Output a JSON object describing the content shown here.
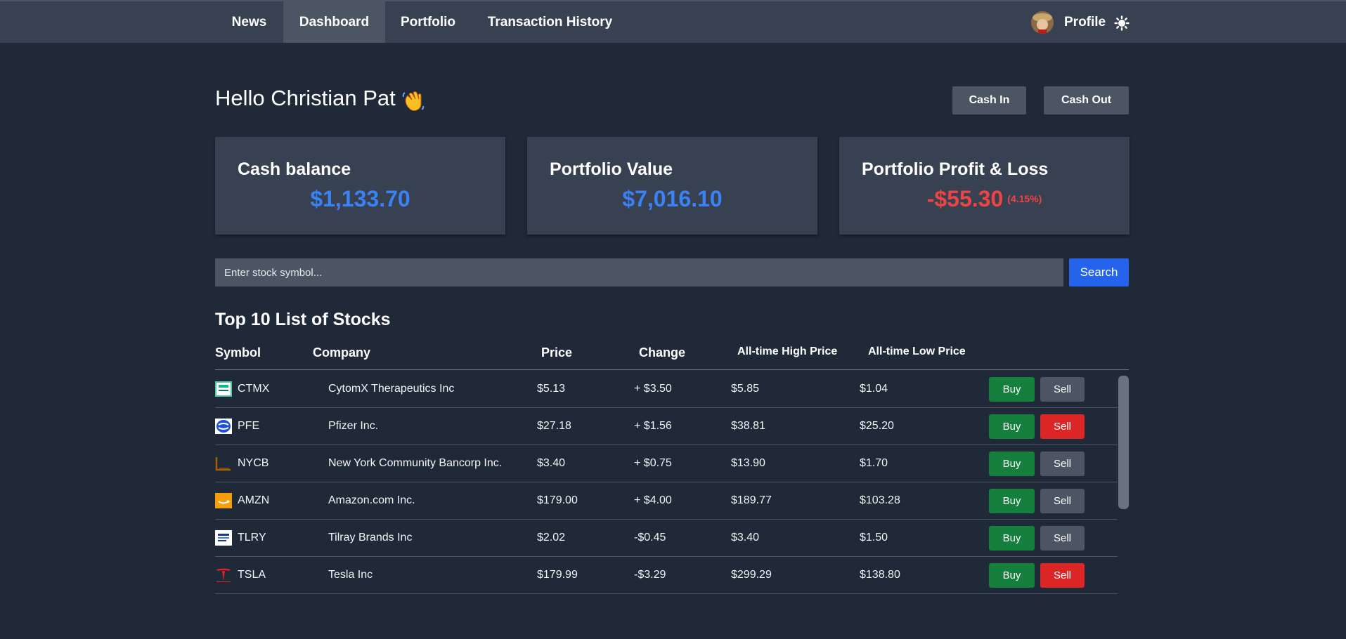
{
  "nav": {
    "items": [
      "News",
      "Dashboard",
      "Portfolio",
      "Transaction History"
    ],
    "active": "Dashboard",
    "profile_label": "Profile"
  },
  "header": {
    "greeting": "Hello Christian Pat",
    "cash_in_label": "Cash In",
    "cash_out_label": "Cash Out"
  },
  "cards": {
    "cash_balance": {
      "title": "Cash balance",
      "value": "$1,133.70"
    },
    "portfolio_value": {
      "title": "Portfolio Value",
      "value": "$7,016.10"
    },
    "profit_loss": {
      "title": "Portfolio Profit & Loss",
      "value": "-$55.30",
      "percent": "(4.15%)"
    }
  },
  "search": {
    "placeholder": "Enter stock symbol...",
    "button_label": "Search"
  },
  "table": {
    "title": "Top 10 List of Stocks",
    "headers": {
      "symbol": "Symbol",
      "company": "Company",
      "price": "Price",
      "change": "Change",
      "high": "All-time High Price",
      "low": "All-time Low Price"
    },
    "buy_label": "Buy",
    "sell_label": "Sell",
    "rows": [
      {
        "symbol": "CTMX",
        "company": "CytomX Therapeutics Inc",
        "price": "$5.13",
        "change": "+ $3.50",
        "high": "$5.85",
        "low": "$1.04"
      },
      {
        "symbol": "PFE",
        "company": "Pfizer Inc.",
        "price": "$27.18",
        "change": "+ $1.56",
        "high": "$38.81",
        "low": "$25.20"
      },
      {
        "symbol": "NYCB",
        "company": "New York Community Bancorp Inc.",
        "price": "$3.40",
        "change": "+ $0.75",
        "high": "$13.90",
        "low": "$1.70"
      },
      {
        "symbol": "AMZN",
        "company": "Amazon.com Inc.",
        "price": "$179.00",
        "change": "+ $4.00",
        "high": "$189.77",
        "low": "$103.28"
      },
      {
        "symbol": "TLRY",
        "company": "Tilray Brands Inc",
        "price": "$2.02",
        "change": "-$0.45",
        "high": "$3.40",
        "low": "$1.50"
      },
      {
        "symbol": "TSLA",
        "company": "Tesla Inc",
        "price": "$179.99",
        "change": "-$3.29",
        "high": "$299.29",
        "low": "$138.80"
      }
    ]
  },
  "colors": {
    "background": "#1f2937",
    "navbar": "#374151",
    "card": "#374151",
    "accent_blue": "#3b82f6",
    "gain_green": "#22c55e",
    "loss_red": "#ef4444",
    "buy_green": "#15803d",
    "sell_red": "#dc2626",
    "sell_gray": "#4b5563"
  },
  "icons": {
    "theme": "sun-icon",
    "greeting": "waving-hand-icon"
  }
}
